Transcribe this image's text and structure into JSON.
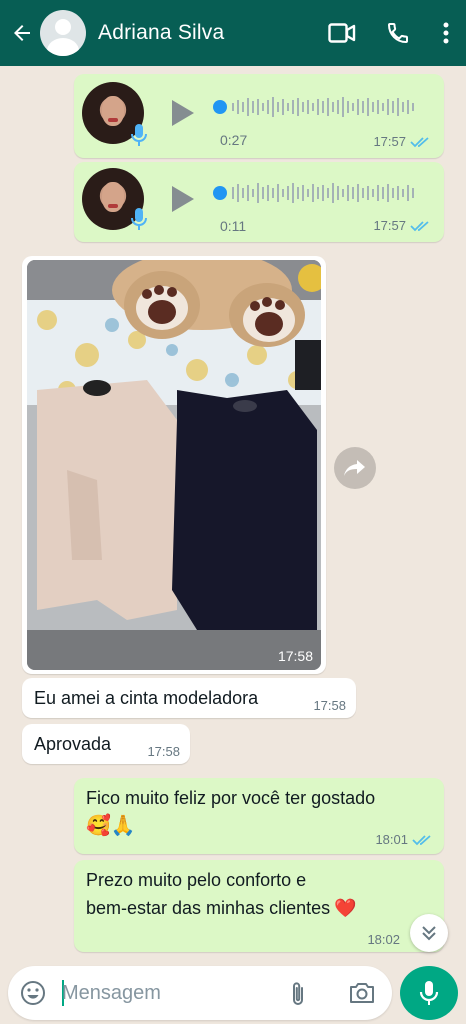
{
  "header": {
    "contact_name": "Adriana Silva",
    "icons": [
      "back-arrow-icon",
      "video-call-icon",
      "phone-icon",
      "more-vert-icon"
    ]
  },
  "messages": {
    "voice1": {
      "duration": "0:27",
      "time": "17:57"
    },
    "voice2": {
      "duration": "0:11",
      "time": "17:57"
    },
    "photo": {
      "time": "17:58"
    },
    "in1": {
      "text": "Eu amei a cinta modeladora",
      "time": "17:58"
    },
    "in2": {
      "text": "Aprovada",
      "time": "17:58"
    },
    "out1": {
      "text": "Fico muito feliz por você ter gostado",
      "emoji": "🥰🙏",
      "time": "18:01"
    },
    "out2": {
      "text_line1": "Prezo muito pelo conforto e",
      "text_line2": "bem-estar das minhas clientes",
      "emoji": "❤️",
      "time": "18:02"
    }
  },
  "composer": {
    "placeholder": "Mensagem"
  },
  "colors": {
    "header": "#075e54",
    "accent": "#00a884",
    "outgoing_bubble": "#dcf8c6",
    "read_ticks": "#53bdeb",
    "background": "#efe7de"
  }
}
